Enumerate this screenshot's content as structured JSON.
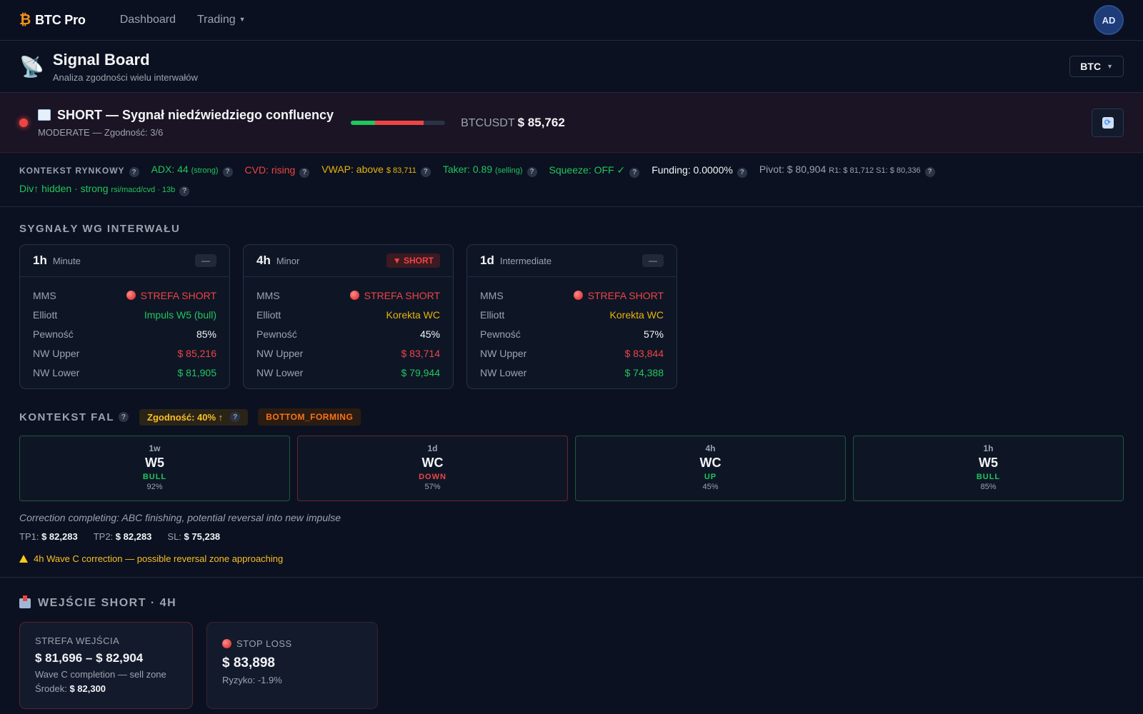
{
  "nav": {
    "logo_symbol": "₿",
    "logo_text": "BTC Pro",
    "dashboard": "Dashboard",
    "trading": "Trading",
    "avatar": "AD"
  },
  "header": {
    "title": "Signal Board",
    "subtitle": "Analiza zgodności wielu interwałów",
    "asset": "BTC"
  },
  "signal": {
    "title": "SHORT — Sygnał niedźwiedziego confluency",
    "subtitle": "MODERATE — Zgodność: 3/6",
    "symbol": "BTCUSDT",
    "price": "$ 85,762"
  },
  "context": {
    "label": "KONTEKST RYNKOWY",
    "adx": "ADX: 44",
    "adx_note": "(strong)",
    "cvd": "CVD: rising",
    "vwap": "VWAP: above",
    "vwap_value": "$ 83,711",
    "taker": "Taker: 0.89",
    "taker_note": "(selling)",
    "squeeze": "Squeeze: OFF ✓",
    "funding": "Funding: 0.0000%",
    "pivot": "Pivot: $ 80,904",
    "pivot_levels": "R1: $ 81,712  S1: $ 80,336",
    "div": "Div↑ hidden · strong",
    "div_note": "rsi/macd/cvd · 13b"
  },
  "intervals": {
    "title": "SYGNAŁY WG INTERWAŁU",
    "cards": [
      {
        "tf": "1h",
        "name": "Minute",
        "badge": "—",
        "mms_label": "MMS",
        "mms": "STREFA SHORT",
        "elliott_label": "Elliott",
        "elliott": "Impuls W5 (bull)",
        "pew_label": "Pewność",
        "pew": "85%",
        "upper_label": "NW Upper",
        "upper": "$ 85,216",
        "lower_label": "NW Lower",
        "lower": "$ 81,905"
      },
      {
        "tf": "4h",
        "name": "Minor",
        "badge": "▼ SHORT",
        "mms_label": "MMS",
        "mms": "STREFA SHORT",
        "elliott_label": "Elliott",
        "elliott": "Korekta WC",
        "pew_label": "Pewność",
        "pew": "45%",
        "upper_label": "NW Upper",
        "upper": "$ 83,714",
        "lower_label": "NW Lower",
        "lower": "$ 79,944"
      },
      {
        "tf": "1d",
        "name": "Intermediate",
        "badge": "—",
        "mms_label": "MMS",
        "mms": "STREFA SHORT",
        "elliott_label": "Elliott",
        "elliott": "Korekta WC",
        "pew_label": "Pewność",
        "pew": "57%",
        "upper_label": "NW Upper",
        "upper": "$ 83,844",
        "lower_label": "NW Lower",
        "lower": "$ 74,388"
      }
    ]
  },
  "waves": {
    "title": "KONTEKST FAL",
    "agreement": "Zgodność: 40% ↑",
    "state": "BOTTOM_FORMING",
    "cards": [
      {
        "tf": "1w",
        "wave": "W5",
        "dir": "BULL",
        "pct": "92%"
      },
      {
        "tf": "1d",
        "wave": "WC",
        "dir": "DOWN",
        "pct": "57%"
      },
      {
        "tf": "4h",
        "wave": "WC",
        "dir": "UP",
        "pct": "45%"
      },
      {
        "tf": "1h",
        "wave": "W5",
        "dir": "BULL",
        "pct": "85%"
      }
    ],
    "note": "Correction completing: ABC finishing, potential reversal into new impulse",
    "tp1_label": "TP1:",
    "tp1": "$ 82,283",
    "tp2_label": "TP2:",
    "tp2": "$ 82,283",
    "sl_label": "SL:",
    "sl": "$ 75,238",
    "warning": "4h Wave C correction — possible reversal zone approaching"
  },
  "entry": {
    "title": "WEJŚCIE SHORT · 4H",
    "zone_label": "STREFA WEJŚCIA",
    "zone": "$ 81,696 – $ 82,904",
    "zone_desc": "Wave C completion — sell zone",
    "mid_label": "Środek:",
    "mid": "$ 82,300",
    "sl_label": "STOP LOSS",
    "sl": "$ 83,898",
    "risk": "Ryzyko: -1.9%"
  }
}
